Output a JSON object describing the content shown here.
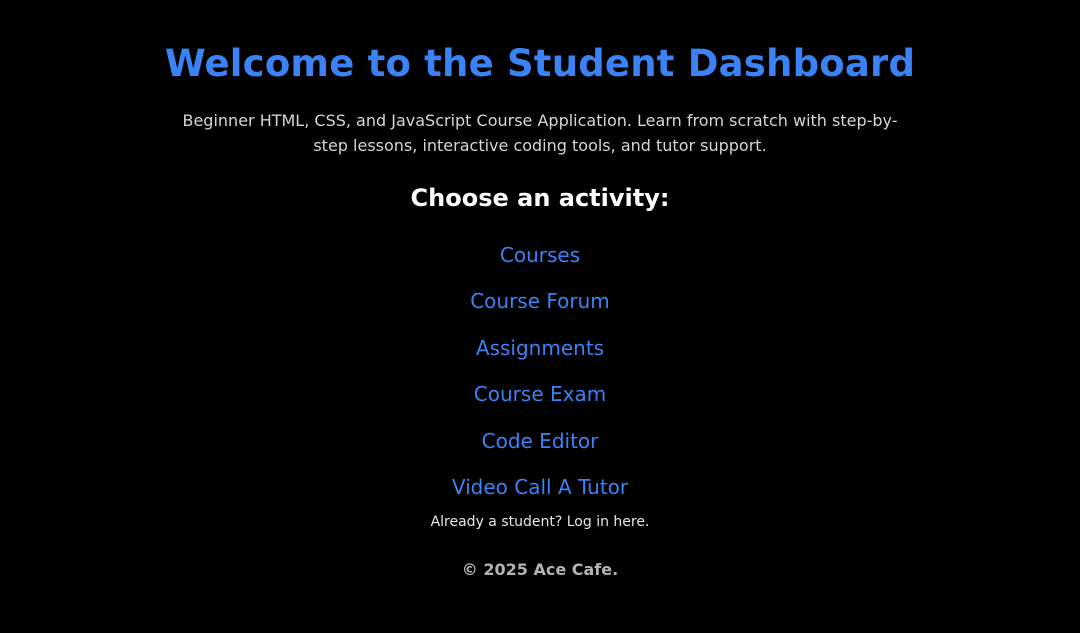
{
  "header": {
    "title": "Welcome to the Student Dashboard",
    "description": "Beginner HTML, CSS, and JavaScript Course Application. Learn from scratch with step-by-step lessons, interactive coding tools, and tutor support."
  },
  "activities": {
    "heading": "Choose an activity:",
    "items": [
      {
        "label": "Courses"
      },
      {
        "label": "Course Forum"
      },
      {
        "label": "Assignments"
      },
      {
        "label": "Course Exam"
      },
      {
        "label": "Code Editor"
      },
      {
        "label": "Video Call A Tutor"
      }
    ]
  },
  "login": {
    "text": "Already a student? Log in here."
  },
  "footer": {
    "copyright": "© 2025 Ace Cafe."
  },
  "colors": {
    "background": "#000000",
    "accent": "#3b82f6",
    "heading_text": "#ffffff",
    "body_text": "#d6d6d6",
    "footer_text": "#b3b3b3"
  }
}
